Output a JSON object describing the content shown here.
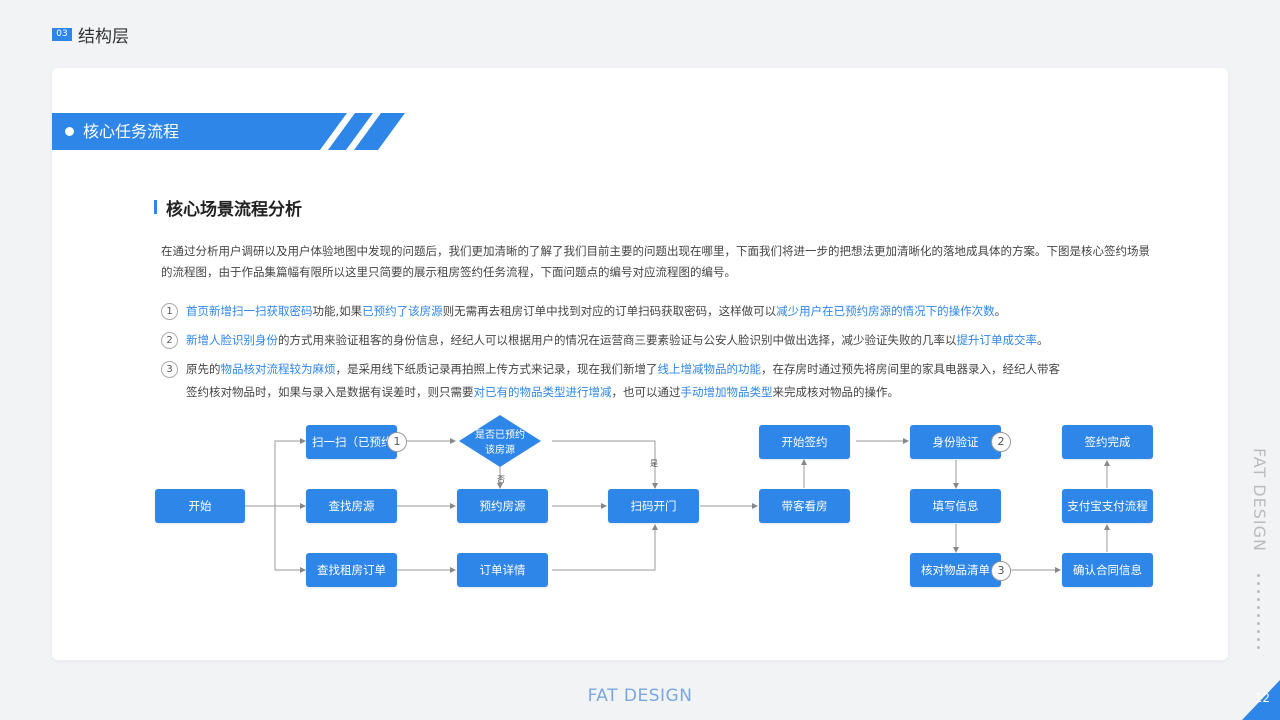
{
  "header": {
    "section_number": "03",
    "section_title": "结构层"
  },
  "banner": {
    "title": "核心任务流程"
  },
  "subsection": {
    "title": "核心场景流程分析"
  },
  "intro": "在通过分析用户调研以及用户体验地图中发现的问题后，我们更加清晰的了解了我们目前主要的问题出现在哪里，下面我们将进一步的把想法更加清晰化的落地成具体的方案。下图是核心签约场景的流程图，由于作品集篇幅有限所以这里只简要的展示租房签约任务流程，下面问题点的编号对应流程图的编号。",
  "points": [
    {
      "number": "1",
      "segments": [
        {
          "text": "首页新增扫一扫获取密码",
          "hl": true
        },
        {
          "text": "功能,如果",
          "hl": false
        },
        {
          "text": "已预约了该房源",
          "hl": true
        },
        {
          "text": "则无需再去租房订单中找到对应的订单扫码获取密码，这样做可以",
          "hl": false
        },
        {
          "text": "减少用户在已预约房源的情况下的操作次数",
          "hl": true
        },
        {
          "text": "。",
          "hl": false
        }
      ]
    },
    {
      "number": "2",
      "segments": [
        {
          "text": "新增人脸识别身份",
          "hl": true
        },
        {
          "text": "的方式用来验证租客的身份信息，经纪人可以根据用户的情况在运营商三要素验证与公安人脸识别中做出选择，减少验证失败的几率以",
          "hl": false
        },
        {
          "text": "提升订单成交率",
          "hl": true
        },
        {
          "text": "。",
          "hl": false
        }
      ]
    },
    {
      "number": "3",
      "segments": [
        {
          "text": "原先的",
          "hl": false
        },
        {
          "text": "物品核对流程较为麻烦",
          "hl": true
        },
        {
          "text": "，是采用线下纸质记录再拍照上传方式来记录，现在我们新增了",
          "hl": false
        },
        {
          "text": "线上增减物品的功能",
          "hl": true
        },
        {
          "text": "，在存房时通过预先将房间里的家具电器录入，经纪人带客签约核对物品时，如果与录入是数据有误差时，则只需要",
          "hl": false
        },
        {
          "text": "对已有的物品类型进行增减",
          "hl": true
        },
        {
          "text": "，也可以通过",
          "hl": false
        },
        {
          "text": "手动增加物品类型",
          "hl": true
        },
        {
          "text": "来完成核对物品的操作。",
          "hl": false
        }
      ]
    }
  ],
  "flow": {
    "start": "开始",
    "scan": "扫一扫（已预约）",
    "search_house": "查找房源",
    "search_order": "查找租房订单",
    "decision_line1": "是否已预约",
    "decision_line2": "该房源",
    "reserve": "预约房源",
    "order_detail": "订单详情",
    "scan_open": "扫码开门",
    "show_house": "带客看房",
    "start_sign": "开始签约",
    "identity": "身份验证",
    "fill_info": "填写信息",
    "check_items": "核对物品清单",
    "confirm_contract": "确认合同信息",
    "alipay": "支付宝支付流程",
    "sign_done": "签约完成",
    "yes_label": "是",
    "no_label": "否",
    "badge1": "1",
    "badge2": "2",
    "badge3": "3"
  },
  "side_text": "FAT DESIGN",
  "footer": "FAT DESIGN",
  "page_number": "12",
  "colors": {
    "accent": "#2f86e9",
    "background": "#f2f3f5",
    "card": "#ffffff"
  }
}
